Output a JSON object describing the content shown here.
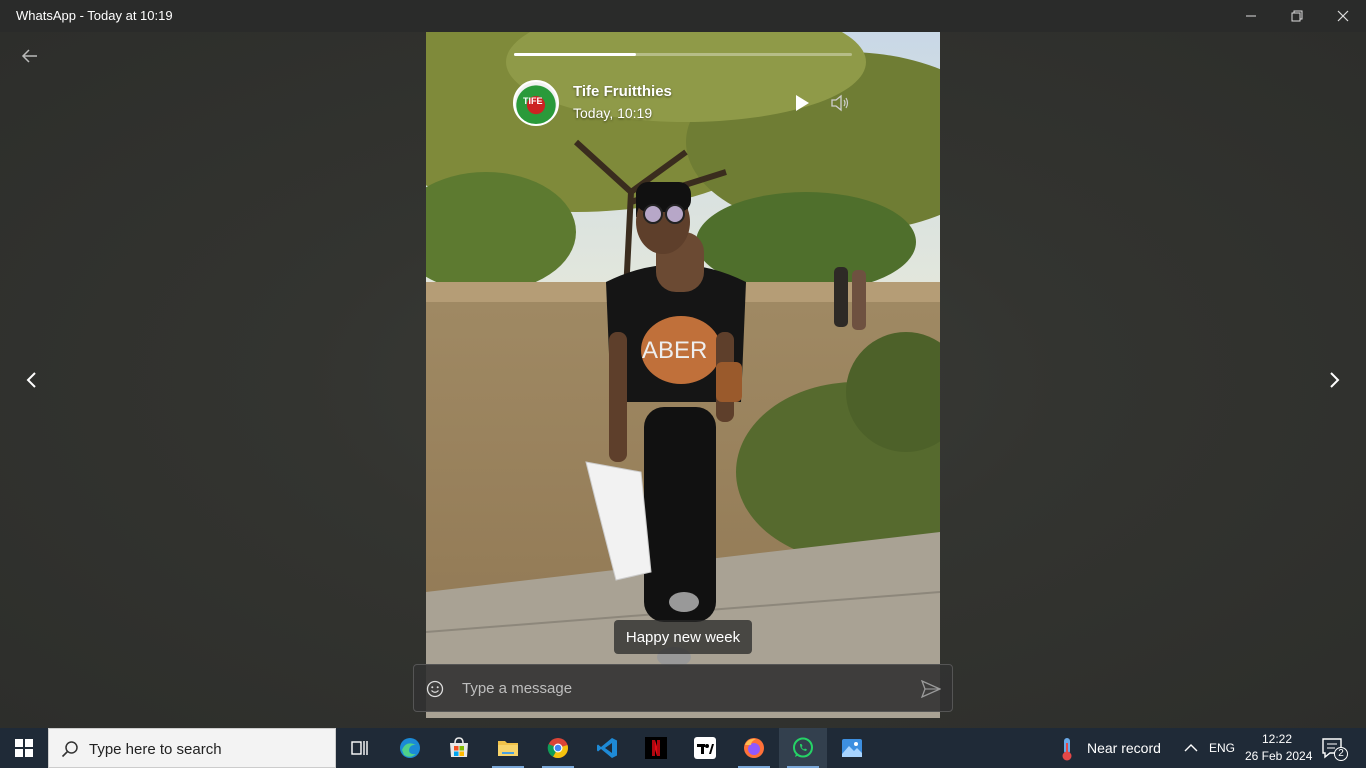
{
  "window": {
    "title": "WhatsApp - Today at 10:19"
  },
  "status": {
    "contact_name": "Tife Fruitthies",
    "timestamp": "Today, 10:19",
    "avatar_text": "TIFE",
    "progress": 0.36,
    "caption": "Happy new week",
    "shirt_text": "ABER"
  },
  "reply": {
    "placeholder": "Type a message"
  },
  "taskbar": {
    "search_placeholder": "Type here to search",
    "apps": [
      {
        "name": "task-view",
        "icon": "task-view-icon"
      },
      {
        "name": "edge",
        "icon": "edge-icon"
      },
      {
        "name": "store",
        "icon": "microsoft-store-icon"
      },
      {
        "name": "file-explorer",
        "icon": "folder-icon"
      },
      {
        "name": "chrome",
        "icon": "chrome-icon"
      },
      {
        "name": "vscode",
        "icon": "vscode-icon"
      },
      {
        "name": "netflix",
        "icon": "netflix-icon"
      },
      {
        "name": "tradingview",
        "icon": "tradingview-icon"
      },
      {
        "name": "firefox",
        "icon": "firefox-icon"
      },
      {
        "name": "whatsapp",
        "icon": "whatsapp-icon"
      },
      {
        "name": "photos",
        "icon": "photos-icon"
      }
    ],
    "weather": "Near record",
    "language": "ENG",
    "time": "12:22",
    "date": "26 Feb 2024",
    "notifications": "2"
  },
  "colors": {
    "whatsapp_green": "#25d366",
    "taskbar_bg": "#1f2a37",
    "viewer_bg": "#2c2d2c"
  }
}
